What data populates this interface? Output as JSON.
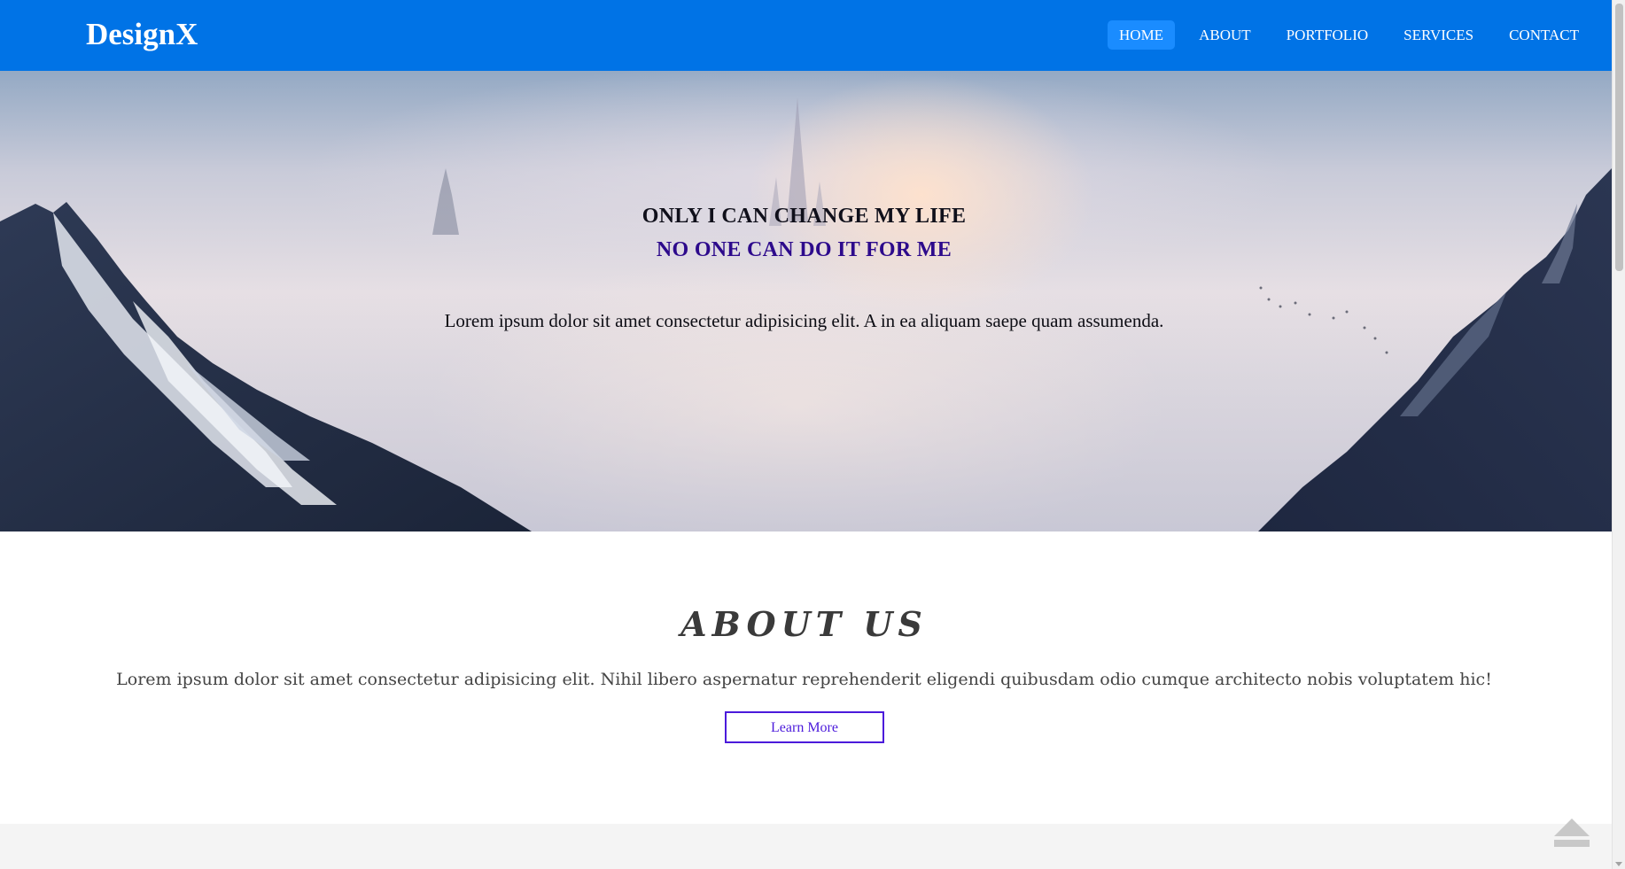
{
  "brand": "DesignX",
  "nav": {
    "items": [
      {
        "label": "HOME",
        "active": true
      },
      {
        "label": "ABOUT",
        "active": false
      },
      {
        "label": "PORTFOLIO",
        "active": false
      },
      {
        "label": "SERVICES",
        "active": false
      },
      {
        "label": "CONTACT",
        "active": false
      }
    ]
  },
  "hero": {
    "title": "ONLY I CAN CHANGE MY LIFE",
    "subtitle": "NO ONE CAN DO IT FOR ME",
    "description": "Lorem ipsum dolor sit amet consectetur adipisicing elit. A in ea aliquam saepe quam assumenda."
  },
  "about": {
    "title": "ABOUT US",
    "text": "Lorem ipsum dolor sit amet consectetur adipisicing elit. Nihil libero aspernatur reprehenderit eligendi quibusdam odio cumque architecto nobis voluptatem hic!",
    "button_label": "Learn More"
  },
  "icons": {
    "scroll_top": "arrow-up-icon"
  },
  "colors": {
    "navbar": "#0073e6",
    "nav_active": "#1a8cff",
    "subtitle": "#2d0a8c",
    "button_border": "#4b1adb"
  }
}
